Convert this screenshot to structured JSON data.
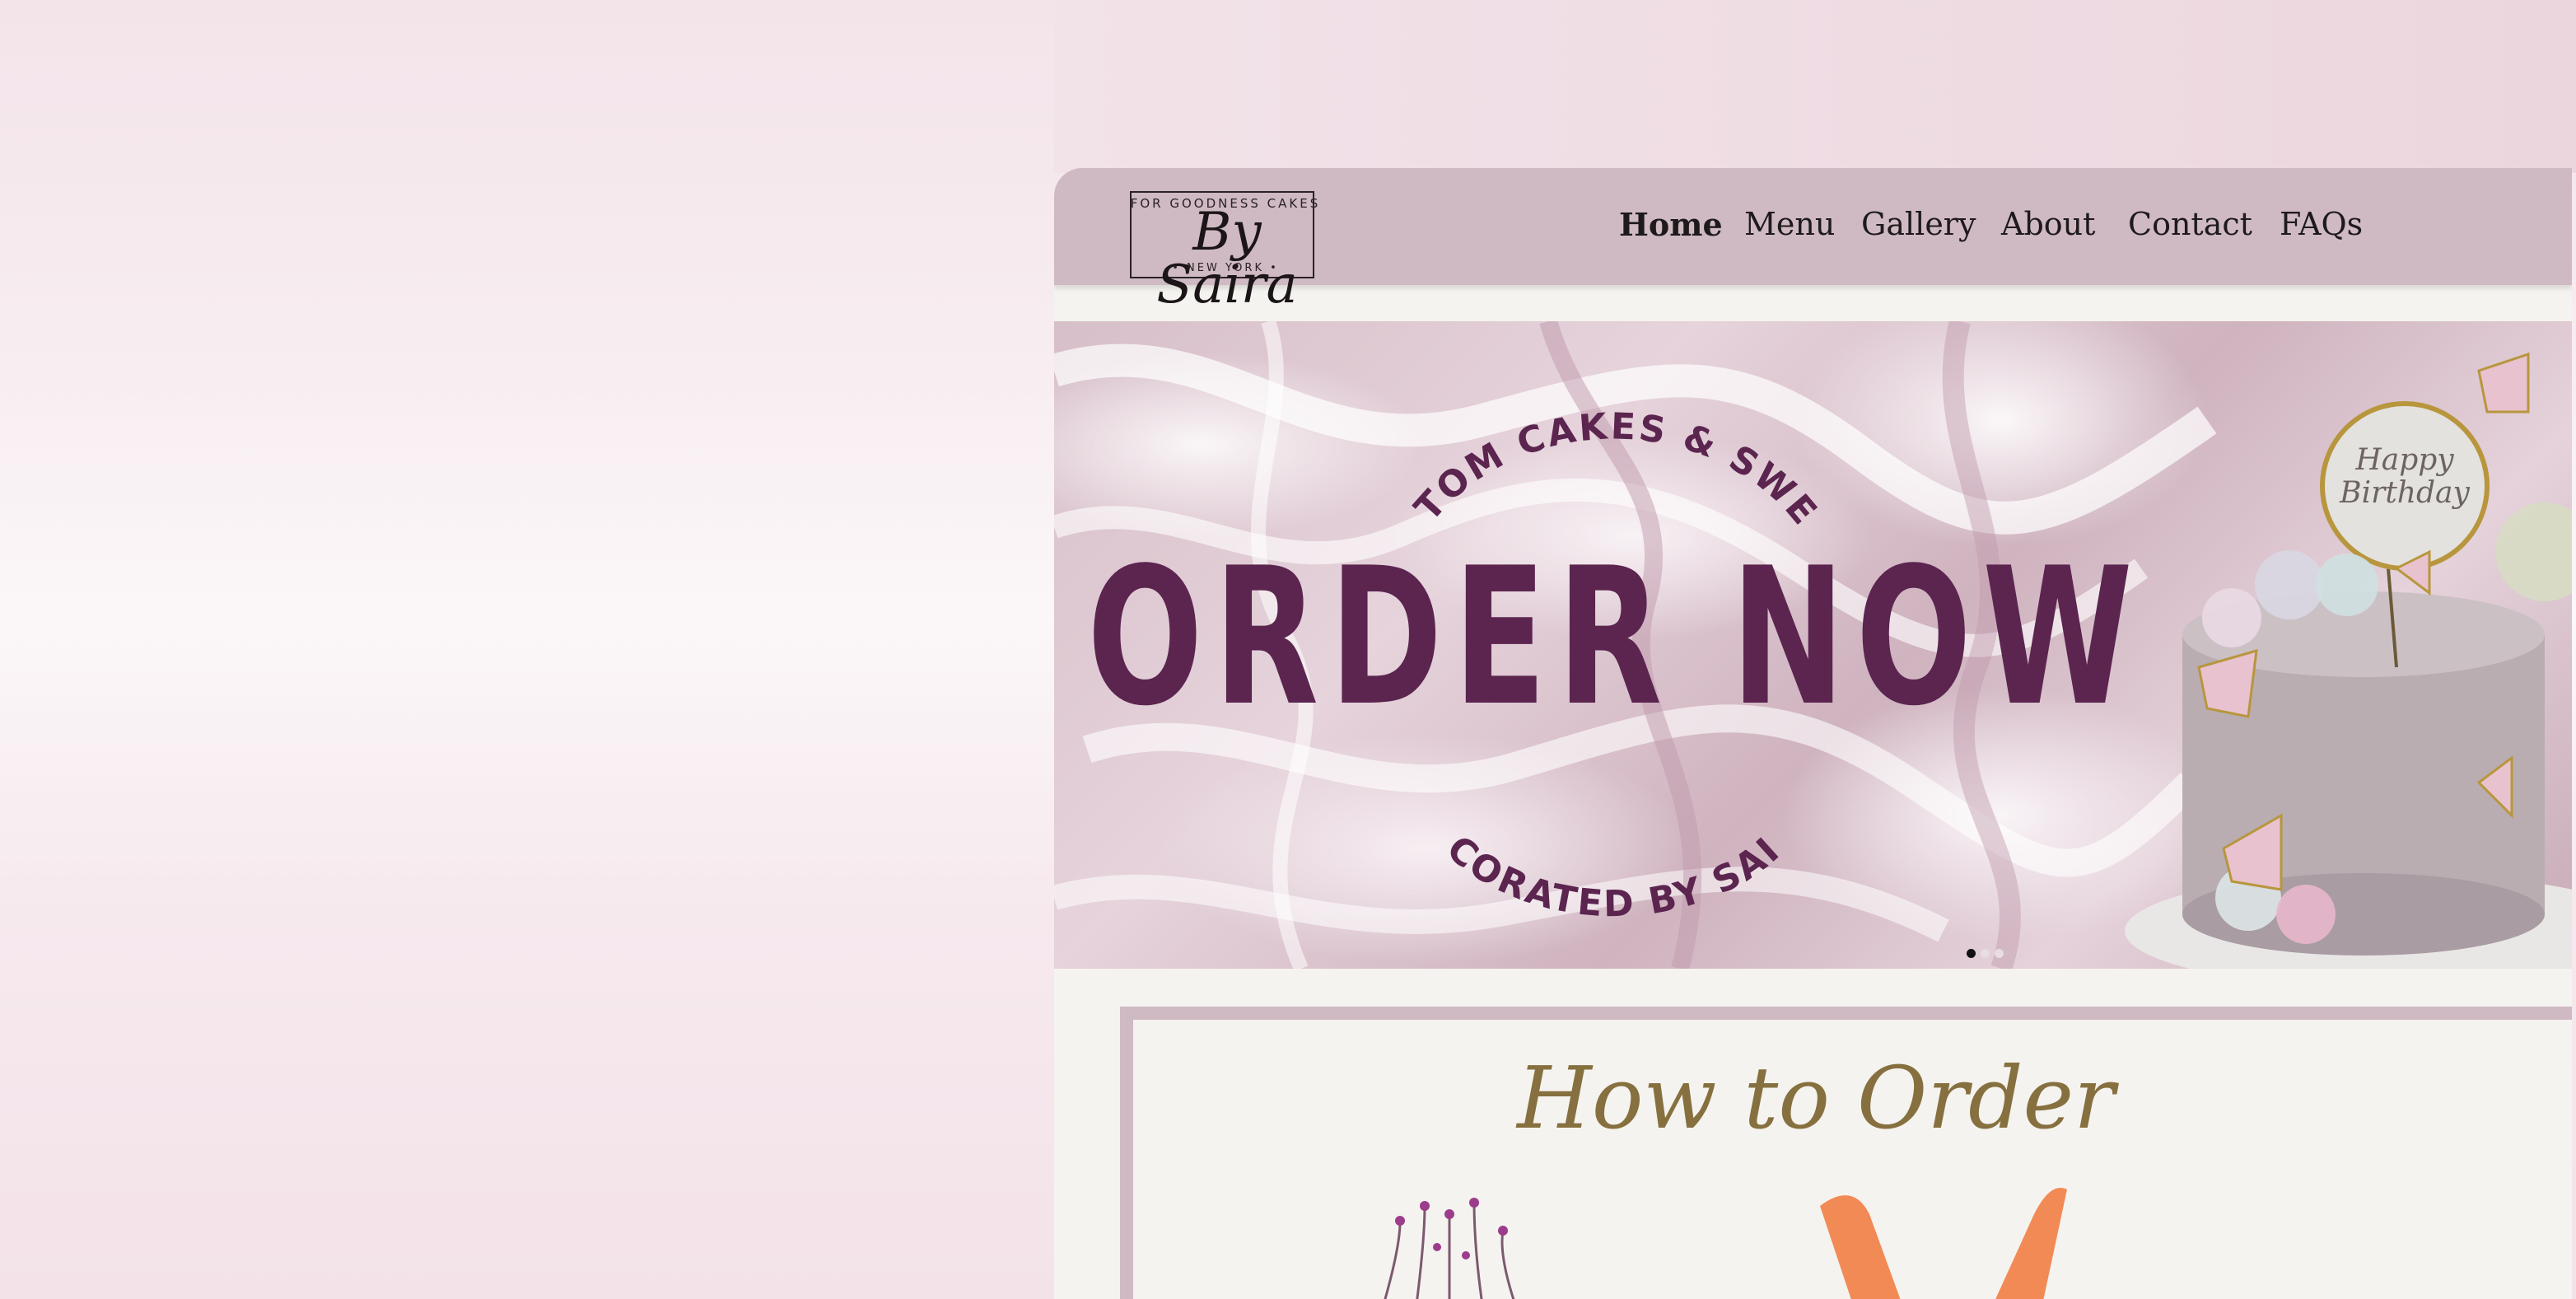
{
  "logo": {
    "top_text": "FOR GOODNESS CAKES",
    "script_text": "By Saira",
    "bottom_text": "• NEW YORK •"
  },
  "nav": {
    "items": [
      {
        "label": "Home",
        "active": true
      },
      {
        "label": "Menu",
        "active": false
      },
      {
        "label": "Gallery",
        "active": false
      },
      {
        "label": "About",
        "active": false
      },
      {
        "label": "Contact",
        "active": false
      },
      {
        "label": "FAQs",
        "active": false
      }
    ]
  },
  "hero": {
    "arc_top": "CUSTOM CAKES & SWEETS",
    "headline": "ORDER NOW",
    "arc_bottom": "DECORATED BY SAIRA",
    "topper_line1": "Happy",
    "topper_line2": "Birthday",
    "slide_count": 3,
    "active_slide": 1
  },
  "how_to_order": {
    "title": "How to Order"
  },
  "colors": {
    "navbar": "#cfb9c3",
    "headline": "#5b2550",
    "title_gold": "#86703f",
    "page_bg": "#f5f3ef"
  }
}
